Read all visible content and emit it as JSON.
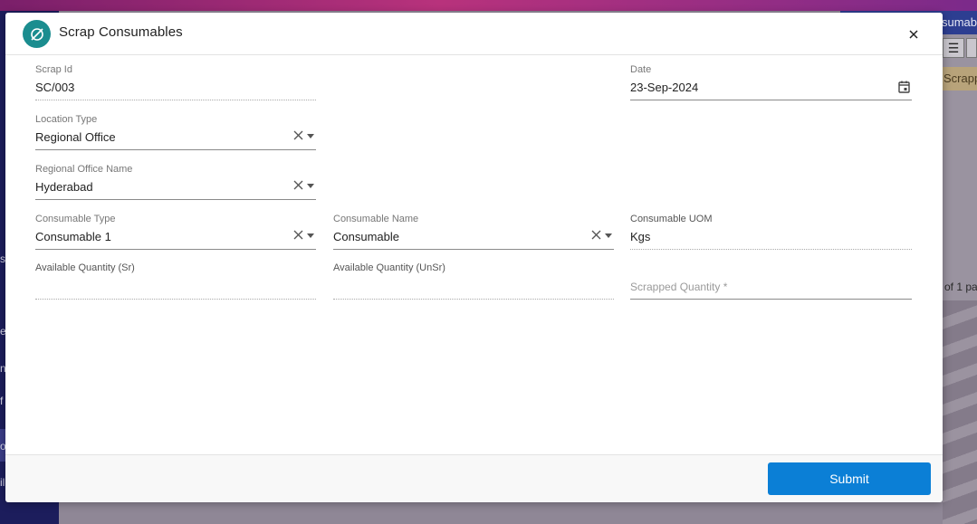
{
  "background": {
    "tab_label": "sumab",
    "menu_icon": "hamburger-icon",
    "scrap_label": "Scrapp",
    "pager_text": "of 1 pa",
    "sidebar_fragments": [
      "s",
      "e",
      "n",
      "f",
      "o",
      "il"
    ]
  },
  "modal": {
    "title": "Scrap Consumables",
    "header_icon": "empty-set-icon",
    "header_icon_color": "#1b8d8f",
    "close_icon": "close-icon",
    "fields": {
      "scrap_id": {
        "label": "Scrap Id",
        "value": "SC/003"
      },
      "date": {
        "label": "Date",
        "value": "23-Sep-2024"
      },
      "location_type": {
        "label": "Location Type",
        "value": "Regional Office"
      },
      "regional_office_name": {
        "label": "Regional Office Name",
        "value": "Hyderabad"
      },
      "consumable_type": {
        "label": "Consumable Type",
        "value": "Consumable 1"
      },
      "consumable_name": {
        "label": "Consumable Name",
        "value": "Consumable"
      },
      "consumable_uom": {
        "label": "Consumable UOM",
        "value": "Kgs"
      },
      "available_qty_sr": {
        "label": "Available Quantity (Sr)",
        "value": ""
      },
      "available_qty_unsr": {
        "label": "Available Quantity (UnSr)",
        "value": ""
      },
      "scrapped_qty": {
        "placeholder": "Scrapped Quantity *",
        "value": ""
      }
    },
    "submit_label": "Submit",
    "submit_color": "#0b7fd6"
  }
}
